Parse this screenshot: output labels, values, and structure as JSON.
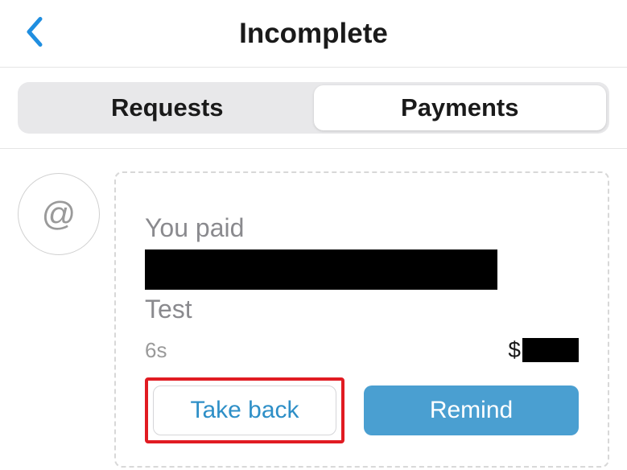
{
  "header": {
    "title": "Incomplete"
  },
  "tabs": {
    "requests": "Requests",
    "payments": "Payments"
  },
  "avatar": {
    "symbol": "@"
  },
  "transaction": {
    "paid_label": "You paid",
    "memo": "Test",
    "timestamp": "6s",
    "currency_symbol": "$"
  },
  "buttons": {
    "take_back": "Take back",
    "remind": "Remind"
  }
}
